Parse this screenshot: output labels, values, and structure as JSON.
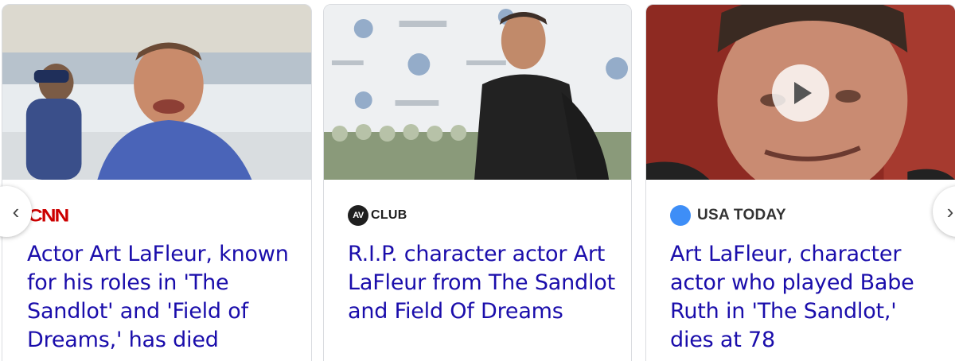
{
  "articles": [
    {
      "source": "CNN",
      "headline": "Actor Art LaFleur, known for his roles in 'The Sandlot' and 'Field of Dreams,' has died",
      "source_color": "#cc0000"
    },
    {
      "source_badge": "AV",
      "source": "CLUB",
      "headline": "R.I.P. character actor Art LaFleur from The Sandlot and Field Of Dreams"
    },
    {
      "source": "USA TODAY",
      "headline": "Art LaFleur, character actor who played Babe Ruth in 'The Sandlot,' dies at 78",
      "source_color": "#3e8ef7",
      "has_video": true
    }
  ],
  "nav": {
    "prev_icon": "chevron-left-icon",
    "next_icon": "chevron-right-icon",
    "prev_glyph": "‹",
    "next_glyph": "›"
  },
  "colors": {
    "headline": "#1a0dab",
    "border": "#dadce0"
  }
}
